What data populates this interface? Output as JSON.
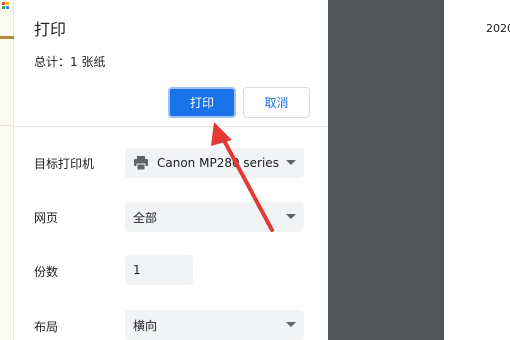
{
  "dialog": {
    "title": "打印",
    "total": "总计：1 张纸",
    "print_button": "打印",
    "cancel_button": "取消"
  },
  "settings": {
    "destination": {
      "label": "目标打印机",
      "value": "Canon MP280 series"
    },
    "pages": {
      "label": "网页",
      "value": "全部"
    },
    "copies": {
      "label": "份数",
      "value": "1"
    },
    "layout": {
      "label": "布局",
      "value": "横向"
    }
  },
  "preview": {
    "date_text": "2020"
  },
  "icons": {
    "destination": "printer-icon",
    "dropdown": "chevron-down-icon"
  },
  "colors": {
    "primary": "#1a73e8",
    "annotation_arrow": "#e53935",
    "preview_background": "#525659"
  }
}
